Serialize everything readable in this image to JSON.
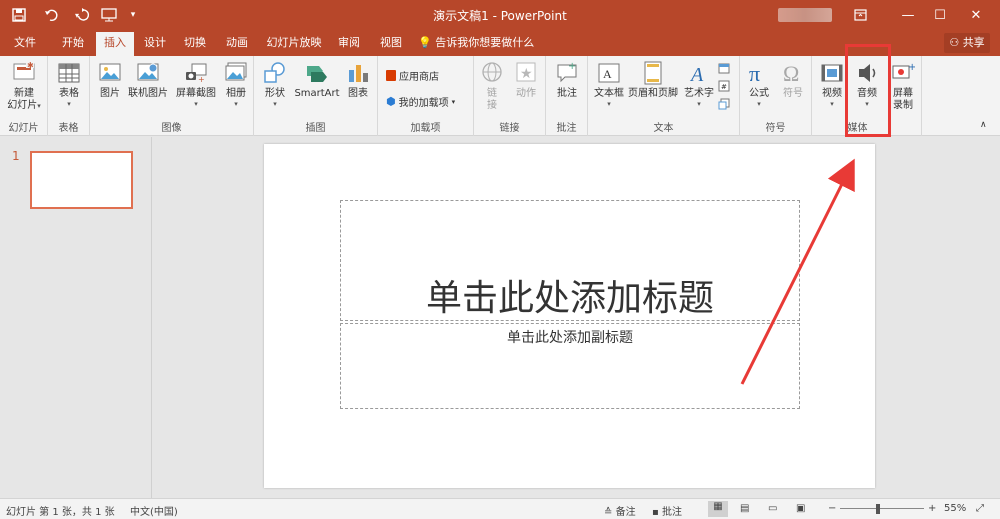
{
  "titlebar": {
    "title": "演示文稿1 - PowerPoint",
    "save_icon": "save-icon",
    "undo_icon": "undo-icon",
    "redo_icon": "redo-icon",
    "present_icon": "present-from-beginning-icon",
    "customize_icon": "customize-qa-icon"
  },
  "tabs": [
    "文件",
    "开始",
    "插入",
    "设计",
    "切换",
    "动画",
    "幻灯片放映",
    "审阅",
    "视图"
  ],
  "active_tab": "插入",
  "tell_me": "告诉我你想要做什么",
  "share": "共享",
  "ribbon": {
    "groups": {
      "slides": "幻灯片",
      "tables": "表格",
      "images": "图像",
      "illustrations": "插图",
      "addins": "加载项",
      "links": "链接",
      "comments": "批注",
      "text": "文本",
      "symbols": "符号",
      "media": "媒体"
    },
    "buttons": {
      "new_slide_1": "新建",
      "new_slide_2": "幻灯片",
      "table": "表格",
      "picture": "图片",
      "online_picture": "联机图片",
      "screenshot": "屏幕截图",
      "album": "相册",
      "shapes": "形状",
      "smartart": "SmartArt",
      "chart": "图表",
      "store": "应用商店",
      "my_addins": "我的加载项",
      "link_1": "链",
      "link_2": "接",
      "action": "动作",
      "comment": "批注",
      "textbox": "文本框",
      "header_footer": "页眉和页脚",
      "wordart": "艺术字",
      "equation": "公式",
      "symbol": "符号",
      "video": "视频",
      "audio": "音频",
      "screen_record_1": "屏幕",
      "screen_record_2": "录制"
    }
  },
  "thumbnails": {
    "slide_number": "1"
  },
  "slide": {
    "title_placeholder": "单击此处添加标题",
    "subtitle_placeholder": "单击此处添加副标题"
  },
  "status": {
    "slide_info": "幻灯片 第 1 张，共 1 张",
    "language": "中文(中国)",
    "notes": "备注",
    "comments": "批注",
    "zoom": "55%"
  },
  "colors": {
    "accent": "#b7472a",
    "highlight": "#e83a36"
  }
}
